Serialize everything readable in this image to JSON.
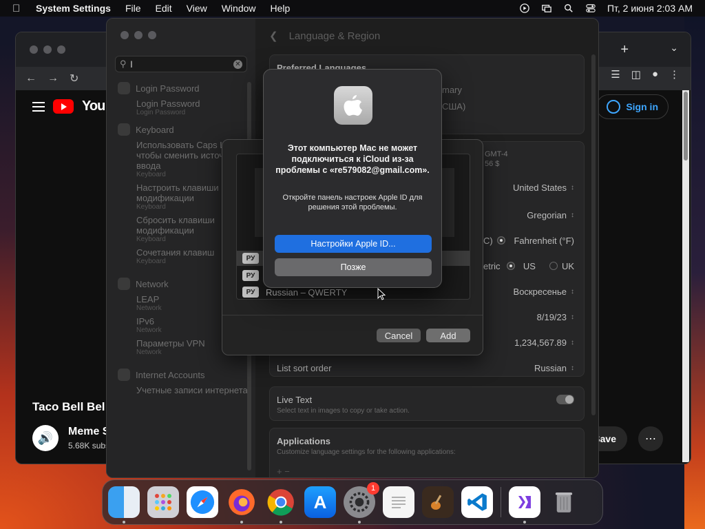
{
  "menubar": {
    "app_name": "System Settings",
    "menus": [
      "File",
      "Edit",
      "View",
      "Window",
      "Help"
    ],
    "datetime": "Пт, 2 июня  2:03 AM"
  },
  "browser": {
    "signin": "Sign in",
    "logo_text": "You",
    "video_title": "Taco Bell Bel",
    "channel_name": "Meme S",
    "channel_subs": "5.68K subs",
    "save": "Save"
  },
  "settings": {
    "search_value": "l",
    "sidebar": {
      "login_password": {
        "group": "Login Password",
        "items": [
          {
            "title": "Login Password",
            "category": "Login Password"
          }
        ]
      },
      "keyboard": {
        "group": "Keyboard",
        "items": [
          {
            "title": "Использовать Caps Lock, чтобы сменить источник ввода",
            "category": "Keyboard"
          },
          {
            "title": "Настроить клавиши модификации",
            "category": "Keyboard"
          },
          {
            "title": "Сбросить клавиши модификации",
            "category": "Keyboard"
          },
          {
            "title": "Сочетания клавиш",
            "category": "Keyboard"
          }
        ]
      },
      "network": {
        "group": "Network",
        "items": [
          {
            "title": "LEAP",
            "category": "Network"
          },
          {
            "title": "IPv6",
            "category": "Network"
          },
          {
            "title": "Параметры VPN",
            "category": "Network"
          }
        ]
      },
      "internet_accounts": {
        "group": "Internet Accounts",
        "items": [
          {
            "title": "Учетные записи интернета"
          }
        ]
      }
    },
    "title": "Language & Region",
    "preferred_languages": "Preferred Languages",
    "primary_partial": "mary",
    "usa_partial": "США)",
    "gmt_partial": "GMT-4",
    "gmt_sub_partial": "56 $",
    "region_value": "United States",
    "calendar_value": "Gregorian",
    "temp_c_partial": "C)",
    "temp_f": "Fahrenheit (°F)",
    "metric_partial": "etric",
    "us": "US",
    "uk": "UK",
    "first_day_value": "Воскресенье",
    "date_format_value": "8/19/23",
    "number_format_value": "1,234,567.89",
    "list_sort_label": "List sort order",
    "list_sort_value": "Russian",
    "live_text_label": "Live Text",
    "live_text_desc": "Select text in images to copy or take action.",
    "applications_label": "Applications",
    "applications_desc": "Customize language settings for the following applications:",
    "add_minus": "+  −"
  },
  "sheet": {
    "badge": "РУ",
    "last_layout": "Russian – QWERTY",
    "cancel": "Cancel",
    "add": "Add"
  },
  "alert": {
    "title": "Этот компьютер Mac не может подключиться к iCloud из-за проблемы с «re579082@gmail.com».",
    "message": "Откройте панель настроек Apple ID для решения этой проблемы.",
    "primary_button": "Настройки Apple ID...",
    "secondary_button": "Позже"
  },
  "dock": {
    "apps": [
      "Finder",
      "Launchpad",
      "Safari",
      "Firefox",
      "Chrome",
      "App Store",
      "System Settings",
      "TextEdit",
      "GarageBand",
      "VS Code",
      "Visual Studio",
      "Trash"
    ],
    "settings_badge": "1"
  },
  "colors": {
    "accent": "#1f6fe0",
    "youtube_red": "#ff0000",
    "badge_red": "#ff3b30"
  }
}
